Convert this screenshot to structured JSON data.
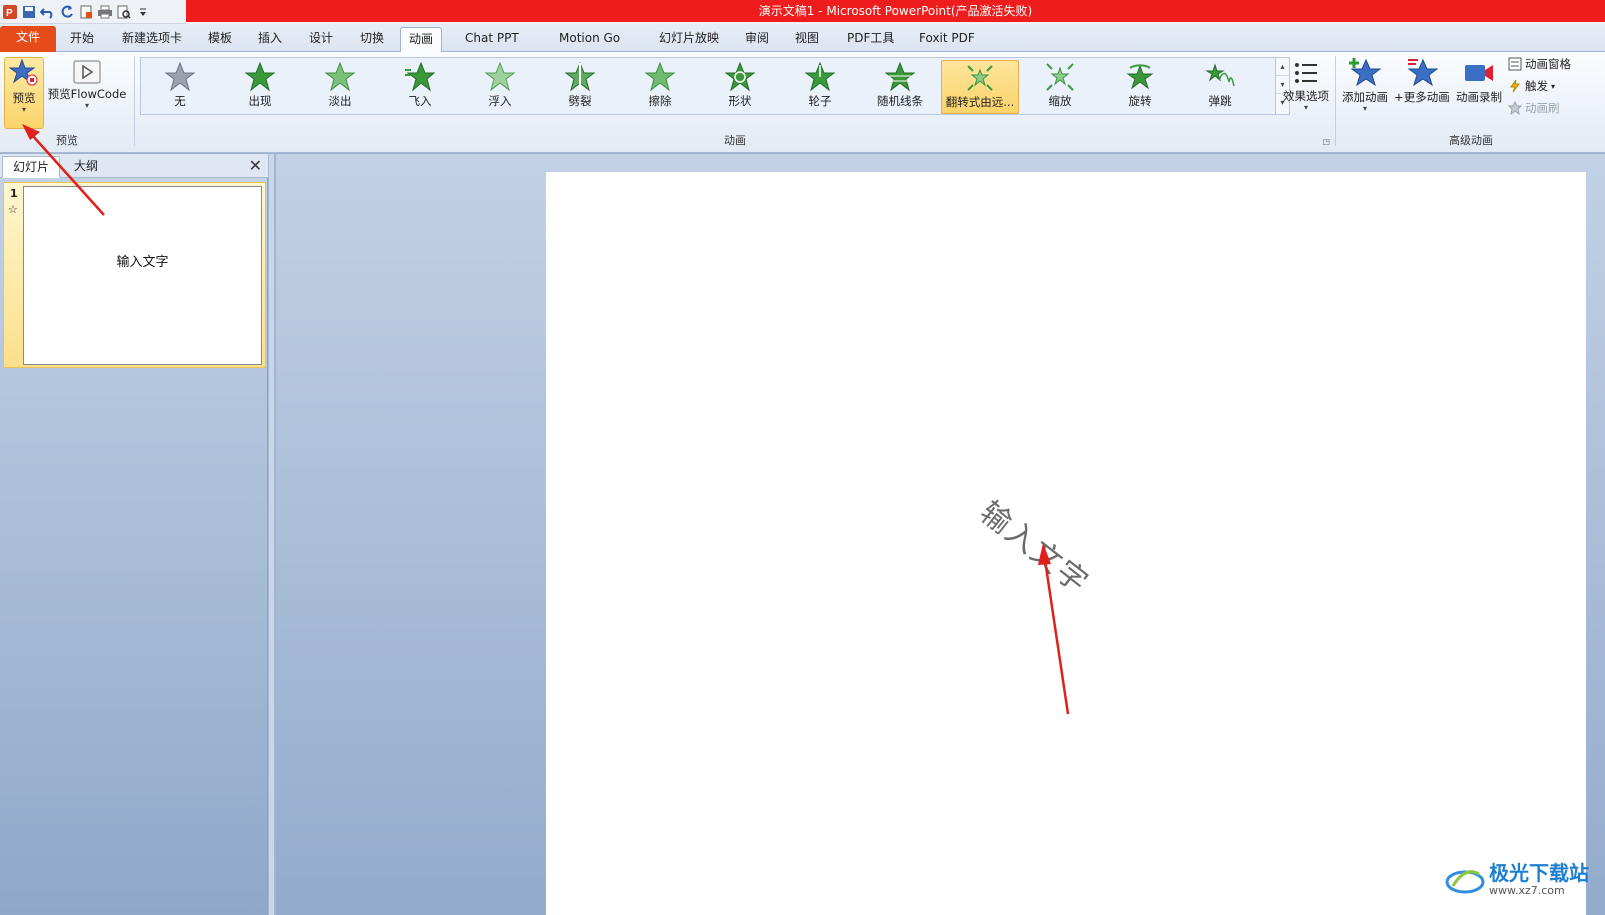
{
  "window": {
    "title": "演示文稿1 - Microsoft PowerPoint(产品激活失败)"
  },
  "tabs": [
    {
      "label": "文件"
    },
    {
      "label": "开始"
    },
    {
      "label": "新建选项卡"
    },
    {
      "label": "模板"
    },
    {
      "label": "插入"
    },
    {
      "label": "设计"
    },
    {
      "label": "切换"
    },
    {
      "label": "动画"
    },
    {
      "label": "Chat PPT"
    },
    {
      "label": "Motion Go"
    },
    {
      "label": "幻灯片放映"
    },
    {
      "label": "审阅"
    },
    {
      "label": "视图"
    },
    {
      "label": "PDF工具"
    },
    {
      "label": "Foxit PDF"
    }
  ],
  "ribbon": {
    "preview_group": {
      "label": "预览",
      "preview": "预览",
      "preview_flowcode": "预览FlowCode"
    },
    "animation_group": {
      "label": "动画",
      "items": [
        {
          "label": "无"
        },
        {
          "label": "出现"
        },
        {
          "label": "淡出"
        },
        {
          "label": "飞入"
        },
        {
          "label": "浮入"
        },
        {
          "label": "劈裂"
        },
        {
          "label": "擦除"
        },
        {
          "label": "形状"
        },
        {
          "label": "轮子"
        },
        {
          "label": "随机线条"
        },
        {
          "label": "翻转式由远..."
        },
        {
          "label": "缩放"
        },
        {
          "label": "旋转"
        },
        {
          "label": "弹跳"
        }
      ],
      "selected_index": 10,
      "effect_options": "效果选项"
    },
    "advanced_group": {
      "label": "高级动画",
      "add_animation": "添加动画",
      "more_animation": "+更多动画",
      "record_animation": "动画录制",
      "animation_pane": "动画窗格",
      "trigger": "触发",
      "animation_painter": "动画刷"
    }
  },
  "left_pane": {
    "tabs": [
      {
        "label": "幻灯片"
      },
      {
        "label": "大纲"
      }
    ],
    "close": "✕",
    "slide_number": "1",
    "slide_star": "☆",
    "thumbnail_text": "输入文字"
  },
  "slide": {
    "text": "输入文字"
  },
  "watermark": {
    "title": "极光下载站",
    "url": "www.xz7.com"
  }
}
